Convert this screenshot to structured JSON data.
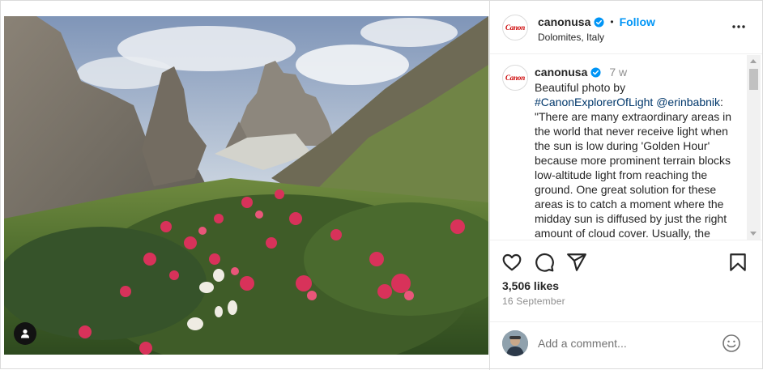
{
  "post": {
    "username": "canonusa",
    "avatar_logo_text": "Canon",
    "follow_label": "Follow",
    "location": "Dolomites, Italy",
    "more_icon": "more-horizontal-icon"
  },
  "caption": {
    "username": "canonusa",
    "time_ago": "7 w",
    "text_before": "Beautiful photo by ",
    "hashtag": "#CanonExplorerOfLight",
    "mention": "@erinbabnik",
    "text_after": ": \"There are many extraordinary areas in the world that never receive light when the sun is low during 'Golden Hour' because more prominent terrain blocks low-altitude light from reaching the ground. One great solution for these areas is to catch a moment where the midday sun is diffused by just the right amount of cloud cover. Usually, the"
  },
  "actions": {
    "icons": [
      "heart-icon",
      "comment-icon",
      "share-icon",
      "bookmark-icon"
    ],
    "likes": "3,506 likes",
    "date": "16 September"
  },
  "comment": {
    "placeholder": "Add a comment...",
    "emoji_icon": "emoji-icon"
  },
  "colors": {
    "accent": "#0095f6",
    "link": "#00376b",
    "verified": "#0095f6",
    "canon_red": "#cc0000"
  }
}
